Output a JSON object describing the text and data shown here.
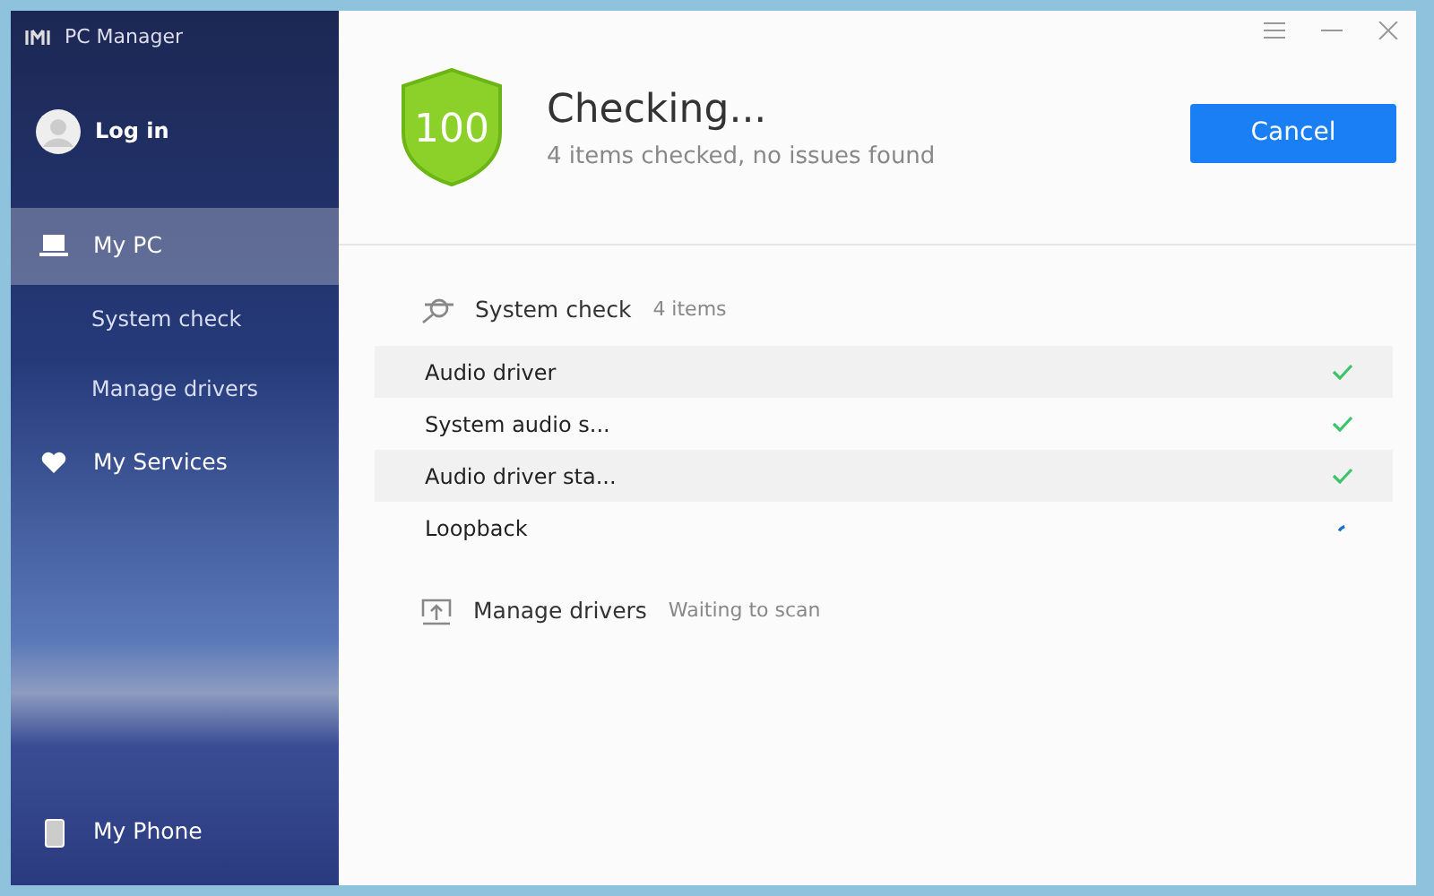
{
  "app": {
    "title": "PC Manager",
    "login": "Log in"
  },
  "sidebar": {
    "items": [
      {
        "label": "My PC",
        "kind": "main",
        "selected": true
      },
      {
        "label": "System check",
        "kind": "sub",
        "selected": false
      },
      {
        "label": "Manage drivers",
        "kind": "sub",
        "selected": false
      },
      {
        "label": "My Services",
        "kind": "main",
        "selected": false
      }
    ],
    "bottom_item": {
      "label": "My Phone",
      "selected": false
    }
  },
  "header": {
    "score": "100",
    "title": "Checking...",
    "subtitle": "4 items checked, no issues found",
    "button": "Cancel"
  },
  "sections": [
    {
      "title": "System check",
      "note": "4 items",
      "items": [
        {
          "label": "Audio driver",
          "checked": true
        },
        {
          "label": "System audio s...",
          "checked": true
        },
        {
          "label": "Audio driver sta...",
          "checked": true
        },
        {
          "label": "Loopback",
          "checked": false
        }
      ]
    },
    {
      "title": "Manage drivers",
      "note": "Waiting to scan"
    }
  ]
}
